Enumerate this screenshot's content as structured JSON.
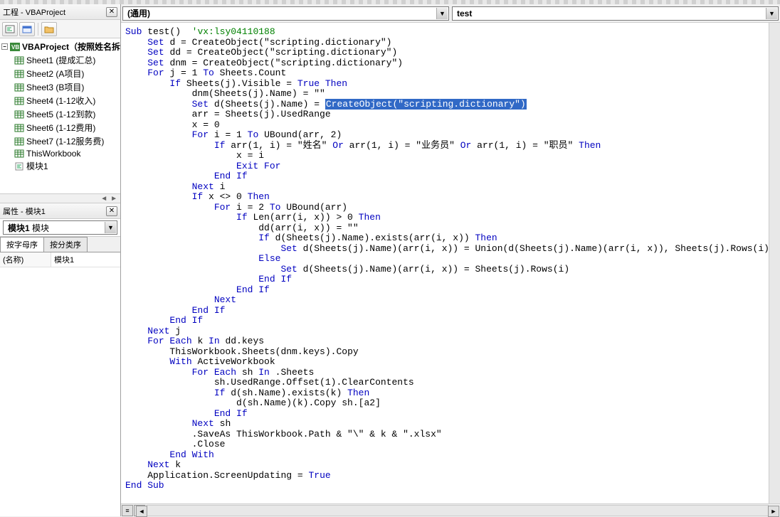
{
  "project_explorer": {
    "title": "工程 - VBAProject",
    "root_name": "VBAProject（按照姓名拆",
    "items": [
      {
        "label": "Sheet1 (提成汇总)"
      },
      {
        "label": "Sheet2 (A项目)"
      },
      {
        "label": "Sheet3 (B项目)"
      },
      {
        "label": "Sheet4 (1-12收入)"
      },
      {
        "label": "Sheet5 (1-12到款)"
      },
      {
        "label": "Sheet6 (1-12费用)"
      },
      {
        "label": "Sheet7 (1-12服务费)"
      },
      {
        "label": "ThisWorkbook"
      },
      {
        "label": "模块1"
      }
    ]
  },
  "properties": {
    "title": "属性 - 模块1",
    "object_name": "模块1",
    "object_type": "模块",
    "tab_alpha": "按字母序",
    "tab_cat": "按分类序",
    "rows": [
      {
        "name": "(名称)",
        "value": "模块1"
      }
    ]
  },
  "combos": {
    "left": "(通用)",
    "right": "test"
  },
  "code": {
    "lines": [
      {
        "indent": 0,
        "segs": [
          {
            "t": "Sub ",
            "c": "kw"
          },
          {
            "t": "test()  "
          },
          {
            "t": "'vx:lsy04110188",
            "c": "cmt"
          }
        ]
      },
      {
        "indent": 1,
        "segs": [
          {
            "t": "Set ",
            "c": "kw"
          },
          {
            "t": "d = CreateObject(\"scripting.dictionary\")"
          }
        ]
      },
      {
        "indent": 1,
        "segs": [
          {
            "t": "Set ",
            "c": "kw"
          },
          {
            "t": "dd = CreateObject(\"scripting.dictionary\")"
          }
        ]
      },
      {
        "indent": 1,
        "segs": [
          {
            "t": "Set ",
            "c": "kw"
          },
          {
            "t": "dnm = CreateObject(\"scripting.dictionary\")"
          }
        ]
      },
      {
        "indent": 1,
        "segs": [
          {
            "t": "For ",
            "c": "kw"
          },
          {
            "t": "j = 1 "
          },
          {
            "t": "To ",
            "c": "kw"
          },
          {
            "t": "Sheets.Count"
          }
        ]
      },
      {
        "indent": 2,
        "segs": [
          {
            "t": "If ",
            "c": "kw"
          },
          {
            "t": "Sheets(j).Visible = "
          },
          {
            "t": "True Then",
            "c": "kw"
          }
        ]
      },
      {
        "indent": 3,
        "segs": [
          {
            "t": "dnm(Sheets(j).Name) = \"\""
          }
        ]
      },
      {
        "indent": 3,
        "segs": [
          {
            "t": "Set ",
            "c": "kw"
          },
          {
            "t": "d(Sheets(j).Name) = "
          },
          {
            "t": "CreateObject(\"scripting.dictionary\")",
            "c": "hl"
          }
        ]
      },
      {
        "indent": 3,
        "segs": [
          {
            "t": "arr = Sheets(j).UsedRange"
          }
        ]
      },
      {
        "indent": 3,
        "segs": [
          {
            "t": "x = 0"
          }
        ]
      },
      {
        "indent": 3,
        "segs": [
          {
            "t": "For ",
            "c": "kw"
          },
          {
            "t": "i = 1 "
          },
          {
            "t": "To ",
            "c": "kw"
          },
          {
            "t": "UBound(arr, 2)"
          }
        ]
      },
      {
        "indent": 4,
        "segs": [
          {
            "t": "If ",
            "c": "kw"
          },
          {
            "t": "arr(1, i) = \"姓名\" "
          },
          {
            "t": "Or ",
            "c": "kw"
          },
          {
            "t": "arr(1, i) = \"业务员\" "
          },
          {
            "t": "Or ",
            "c": "kw"
          },
          {
            "t": "arr(1, i) = \"职员\" "
          },
          {
            "t": "Then",
            "c": "kw"
          }
        ]
      },
      {
        "indent": 5,
        "segs": [
          {
            "t": "x = i"
          }
        ]
      },
      {
        "indent": 5,
        "segs": [
          {
            "t": "Exit For",
            "c": "kw"
          }
        ]
      },
      {
        "indent": 4,
        "segs": [
          {
            "t": "End If",
            "c": "kw"
          }
        ]
      },
      {
        "indent": 3,
        "segs": [
          {
            "t": "Next ",
            "c": "kw"
          },
          {
            "t": "i"
          }
        ]
      },
      {
        "indent": 3,
        "segs": [
          {
            "t": "If ",
            "c": "kw"
          },
          {
            "t": "x <> 0 "
          },
          {
            "t": "Then",
            "c": "kw"
          }
        ]
      },
      {
        "indent": 4,
        "segs": [
          {
            "t": "For ",
            "c": "kw"
          },
          {
            "t": "i = 2 "
          },
          {
            "t": "To ",
            "c": "kw"
          },
          {
            "t": "UBound(arr)"
          }
        ]
      },
      {
        "indent": 5,
        "segs": [
          {
            "t": "If ",
            "c": "kw"
          },
          {
            "t": "Len(arr(i, x)) > 0 "
          },
          {
            "t": "Then",
            "c": "kw"
          }
        ]
      },
      {
        "indent": 6,
        "segs": [
          {
            "t": "dd(arr(i, x)) = \"\""
          }
        ]
      },
      {
        "indent": 6,
        "segs": [
          {
            "t": "If ",
            "c": "kw"
          },
          {
            "t": "d(Sheets(j).Name).exists(arr(i, x)) "
          },
          {
            "t": "Then",
            "c": "kw"
          }
        ]
      },
      {
        "indent": 7,
        "segs": [
          {
            "t": "Set ",
            "c": "kw"
          },
          {
            "t": "d(Sheets(j).Name)(arr(i, x)) = Union(d(Sheets(j).Name)(arr(i, x)), Sheets(j).Rows(i))"
          }
        ]
      },
      {
        "indent": 6,
        "segs": [
          {
            "t": "Else",
            "c": "kw"
          }
        ]
      },
      {
        "indent": 7,
        "segs": [
          {
            "t": "Set ",
            "c": "kw"
          },
          {
            "t": "d(Sheets(j).Name)(arr(i, x)) = Sheets(j).Rows(i)"
          }
        ]
      },
      {
        "indent": 6,
        "segs": [
          {
            "t": "End If",
            "c": "kw"
          }
        ]
      },
      {
        "indent": 5,
        "segs": [
          {
            "t": "End If",
            "c": "kw"
          }
        ]
      },
      {
        "indent": 4,
        "segs": [
          {
            "t": "Next",
            "c": "kw"
          }
        ]
      },
      {
        "indent": 3,
        "segs": [
          {
            "t": "End If",
            "c": "kw"
          }
        ]
      },
      {
        "indent": 2,
        "segs": [
          {
            "t": "End If",
            "c": "kw"
          }
        ]
      },
      {
        "indent": 1,
        "segs": [
          {
            "t": "Next ",
            "c": "kw"
          },
          {
            "t": "j"
          }
        ]
      },
      {
        "indent": 1,
        "segs": [
          {
            "t": "For Each ",
            "c": "kw"
          },
          {
            "t": "k "
          },
          {
            "t": "In ",
            "c": "kw"
          },
          {
            "t": "dd.keys"
          }
        ]
      },
      {
        "indent": 2,
        "segs": [
          {
            "t": "ThisWorkbook.Sheets(dnm.keys).Copy"
          }
        ]
      },
      {
        "indent": 2,
        "segs": [
          {
            "t": "With ",
            "c": "kw"
          },
          {
            "t": "ActiveWorkbook"
          }
        ]
      },
      {
        "indent": 3,
        "segs": [
          {
            "t": "For Each ",
            "c": "kw"
          },
          {
            "t": "sh "
          },
          {
            "t": "In ",
            "c": "kw"
          },
          {
            "t": ".Sheets"
          }
        ]
      },
      {
        "indent": 4,
        "segs": [
          {
            "t": "sh.UsedRange.Offset(1).ClearContents"
          }
        ]
      },
      {
        "indent": 4,
        "segs": [
          {
            "t": "If ",
            "c": "kw"
          },
          {
            "t": "d(sh.Name).exists(k) "
          },
          {
            "t": "Then",
            "c": "kw"
          }
        ]
      },
      {
        "indent": 5,
        "segs": [
          {
            "t": "d(sh.Name)(k).Copy sh.[a2]"
          }
        ]
      },
      {
        "indent": 4,
        "segs": [
          {
            "t": "End If",
            "c": "kw"
          }
        ]
      },
      {
        "indent": 3,
        "segs": [
          {
            "t": "Next ",
            "c": "kw"
          },
          {
            "t": "sh"
          }
        ]
      },
      {
        "indent": 3,
        "segs": [
          {
            "t": ".SaveAs ThisWorkbook.Path & \"\\\" & k & \".xlsx\""
          }
        ]
      },
      {
        "indent": 3,
        "segs": [
          {
            "t": ".Close"
          }
        ]
      },
      {
        "indent": 2,
        "segs": [
          {
            "t": "End With",
            "c": "kw"
          }
        ]
      },
      {
        "indent": 1,
        "segs": [
          {
            "t": "Next ",
            "c": "kw"
          },
          {
            "t": "k"
          }
        ]
      },
      {
        "indent": 1,
        "segs": [
          {
            "t": "Application.ScreenUpdating = "
          },
          {
            "t": "True",
            "c": "kw"
          }
        ]
      },
      {
        "indent": 0,
        "segs": [
          {
            "t": "End Sub",
            "c": "kw"
          }
        ]
      }
    ]
  }
}
